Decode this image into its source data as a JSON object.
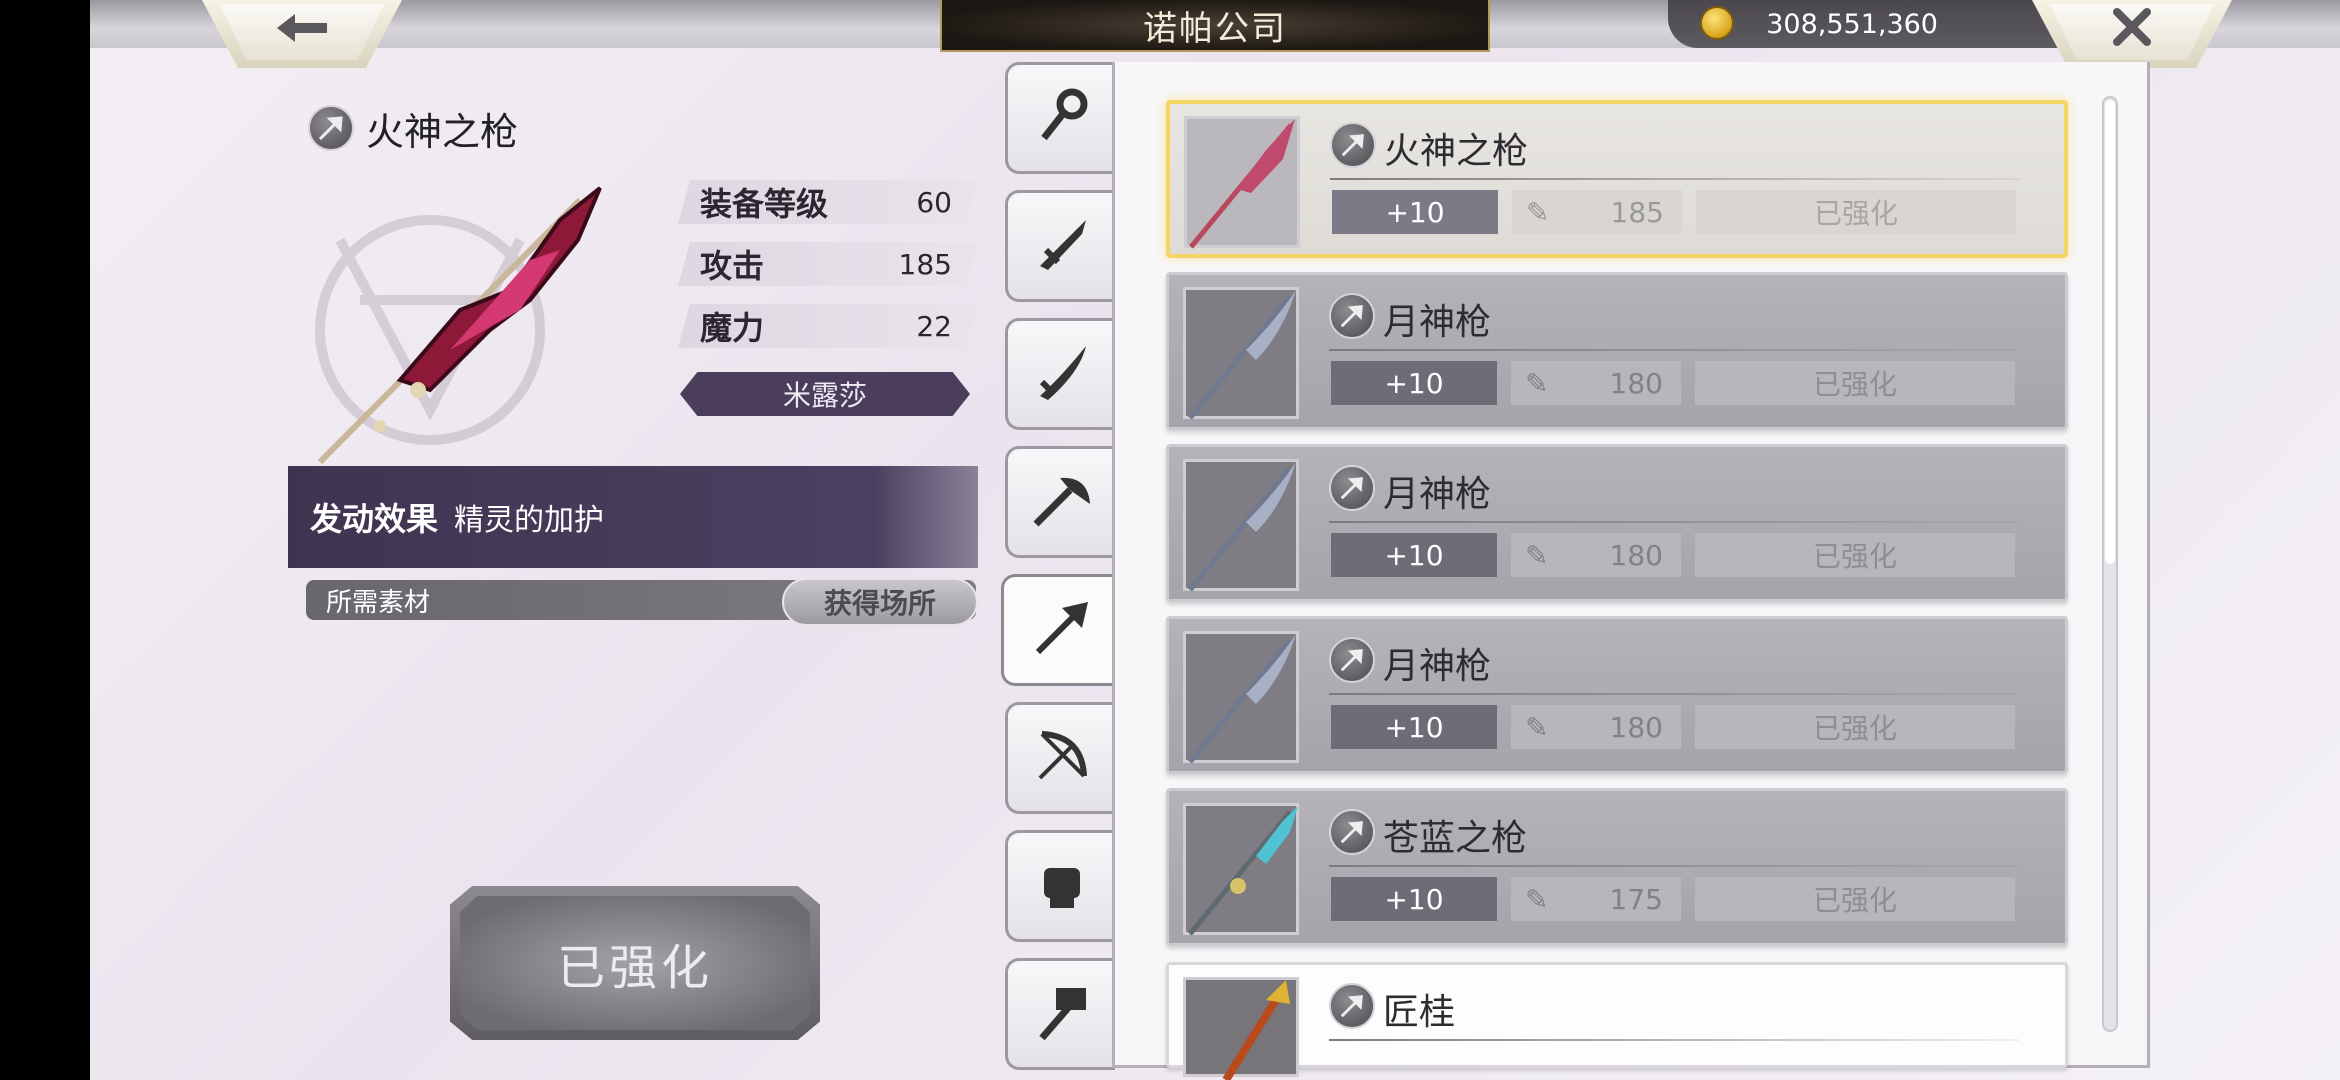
{
  "header": {
    "title": "诺帕公司",
    "currency_amount": "308,551,360",
    "back_icon": "arrow-left-icon",
    "close_icon": "close-icon"
  },
  "detail": {
    "name": "火神之枪",
    "type_icon": "spear-icon",
    "stats": [
      {
        "label": "装备等级",
        "value": "60"
      },
      {
        "label": "攻击",
        "value": "185"
      },
      {
        "label": "魔力",
        "value": "22"
      }
    ],
    "user": "米露莎",
    "effect_label": "发动效果",
    "effect_value": "精灵的加护",
    "material_label": "所需素材",
    "obtain_button": "获得场所",
    "enhance_button": "已强化"
  },
  "tabs": [
    {
      "icon": "staff-icon",
      "active": false
    },
    {
      "icon": "sword-icon",
      "active": false
    },
    {
      "icon": "saber-icon",
      "active": false
    },
    {
      "icon": "axe-icon",
      "active": false
    },
    {
      "icon": "spear-icon",
      "active": true
    },
    {
      "icon": "bow-icon",
      "active": false
    },
    {
      "icon": "fist-icon",
      "active": false
    },
    {
      "icon": "hammer-icon",
      "active": false
    }
  ],
  "list": [
    {
      "name": "火神之枪",
      "plus": "+10",
      "atk": "185",
      "state": "已强化",
      "selected": true
    },
    {
      "name": "月神枪",
      "plus": "+10",
      "atk": "180",
      "state": "已强化",
      "selected": false
    },
    {
      "name": "月神枪",
      "plus": "+10",
      "atk": "180",
      "state": "已强化",
      "selected": false
    },
    {
      "name": "月神枪",
      "plus": "+10",
      "atk": "180",
      "state": "已强化",
      "selected": false
    },
    {
      "name": "苍蓝之枪",
      "plus": "+10",
      "atk": "175",
      "state": "已强化",
      "selected": false
    },
    {
      "name": "匠桂",
      "selected": false
    }
  ],
  "colors": {
    "selected_border": "#f4d464",
    "effect_band": "#3f3450"
  }
}
